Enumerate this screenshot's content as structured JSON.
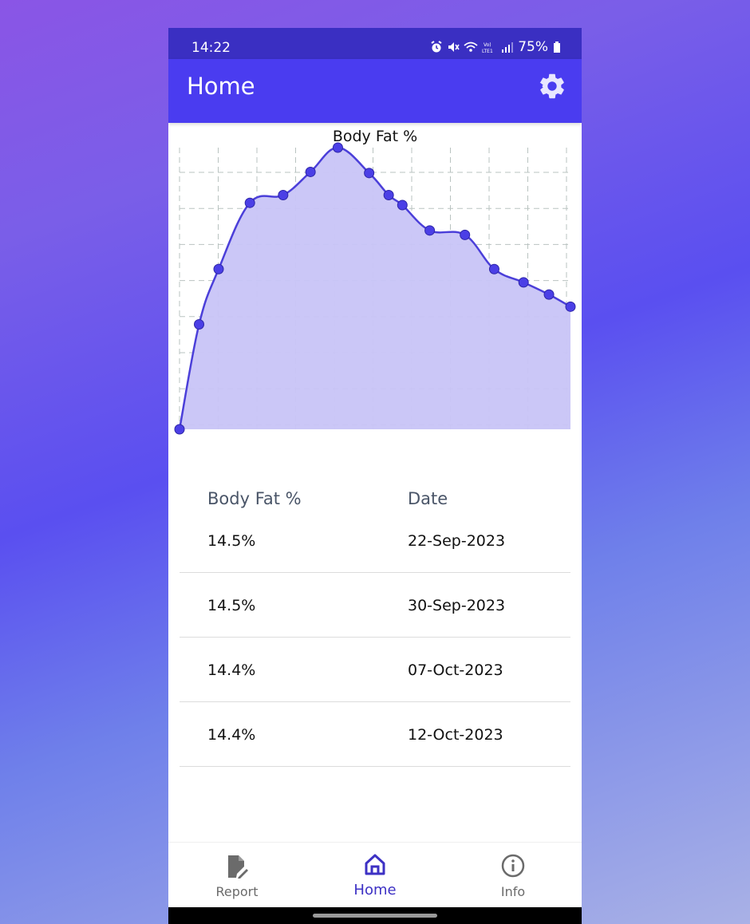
{
  "status_bar": {
    "time": "14:22",
    "battery": "75%",
    "icons": [
      "alarm-icon",
      "mute-icon",
      "wifi-icon",
      "volte-icon",
      "signal-icon",
      "battery-icon"
    ]
  },
  "app_bar": {
    "title": "Home",
    "settings_icon": "gear-icon"
  },
  "colors": {
    "status_bar": "#3a2fc2",
    "app_bar": "#4a3cf0",
    "accent": "#3d31c4",
    "chart_line": "#4b3fd9",
    "chart_fill": "#c8c4f7"
  },
  "chart_data": {
    "type": "area",
    "title": "Body Fat %",
    "grid": true,
    "xlabel": "",
    "ylabel": "",
    "legend": "none",
    "series": [
      {
        "values": [
          13.45,
          14.4,
          14.9,
          15.5,
          15.57,
          15.78,
          16.0,
          15.77,
          15.57,
          15.48,
          15.25,
          15.21,
          14.9,
          14.78,
          14.67,
          14.56
        ]
      }
    ],
    "x": [
      0.0,
      1.0,
      2.0,
      3.6,
      5.3,
      6.7,
      8.1,
      9.7,
      10.7,
      11.4,
      12.8,
      14.6,
      16.1,
      17.6,
      18.9,
      20.0
    ],
    "ylim": [
      13.45,
      16.0
    ]
  },
  "table": {
    "headers": [
      "Body Fat %",
      "Date"
    ],
    "rows": [
      {
        "value": "14.5%",
        "date": "22-Sep-2023"
      },
      {
        "value": "14.5%",
        "date": "30-Sep-2023"
      },
      {
        "value": "14.4%",
        "date": "07-Oct-2023"
      },
      {
        "value": "14.4%",
        "date": "12-Oct-2023"
      }
    ]
  },
  "bottom_nav": {
    "items": [
      {
        "label": "Report",
        "icon": "report-icon",
        "active": false
      },
      {
        "label": "Home",
        "icon": "home-icon",
        "active": true
      },
      {
        "label": "Info",
        "icon": "info-icon",
        "active": false
      }
    ]
  }
}
